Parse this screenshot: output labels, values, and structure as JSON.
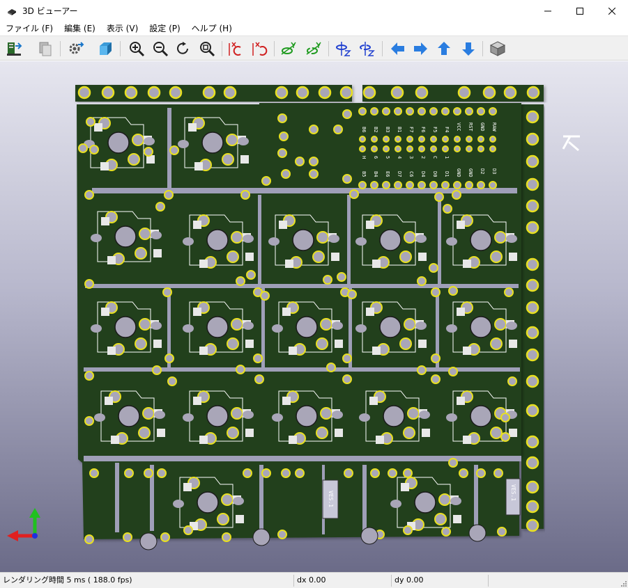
{
  "window": {
    "title": "3D ビューアー",
    "controls": {
      "minimize": "minimize",
      "maximize": "maximize",
      "close": "close"
    }
  },
  "menu": [
    {
      "label": "ファイル (F)"
    },
    {
      "label": "編集 (E)"
    },
    {
      "label": "表示 (V)"
    },
    {
      "label": "設定 (P)"
    },
    {
      "label": "ヘルプ (H)"
    }
  ],
  "toolbar": {
    "icons": [
      "reload-board-icon",
      "copy-image-icon",
      "render-settings-icon",
      "raytracing-icon",
      "zoom-in-icon",
      "zoom-out-icon",
      "redraw-icon",
      "zoom-fit-icon",
      "rotate-x-cw-icon",
      "rotate-x-ccw-icon",
      "rotate-y-cw-icon",
      "rotate-y-ccw-icon",
      "rotate-z-cw-icon",
      "rotate-z-ccw-icon",
      "move-left-icon",
      "move-right-icon",
      "move-up-icon",
      "move-down-icon",
      "orthographic-icon"
    ]
  },
  "board": {
    "pin_labels_top": [
      "B6",
      "B2",
      "B3",
      "B1",
      "F7",
      "F6",
      "F5",
      "F4"
    ],
    "pin_labels_right": [
      "VCC",
      "RST",
      "GND",
      "RAW"
    ],
    "pin_labels_mid": [
      "H",
      "6",
      "5",
      "4",
      "3",
      "2",
      "C",
      "1",
      "-",
      "1"
    ],
    "pin_labels_bottom": [
      "B5",
      "B4",
      "E6",
      "D7",
      "C6",
      "D4",
      "D0",
      "D1",
      "GND",
      "GND",
      "D2",
      "D3"
    ],
    "side_label_1": "VES.1",
    "side_label_2": "VES.1",
    "colors": {
      "soldermask": "#23401f",
      "copper_pad": "#e8e020",
      "silkscreen": "#ffffff",
      "hole": "#a9a6b8"
    }
  },
  "axes": {
    "x_color": "#e02020",
    "y_color": "#20c020",
    "z_color": "#2030e0"
  },
  "status": {
    "render_time": "レンダリング時間 5 ms ( 188.0 fps)",
    "dx": "dx 0.00",
    "dy": "dy 0.00"
  }
}
